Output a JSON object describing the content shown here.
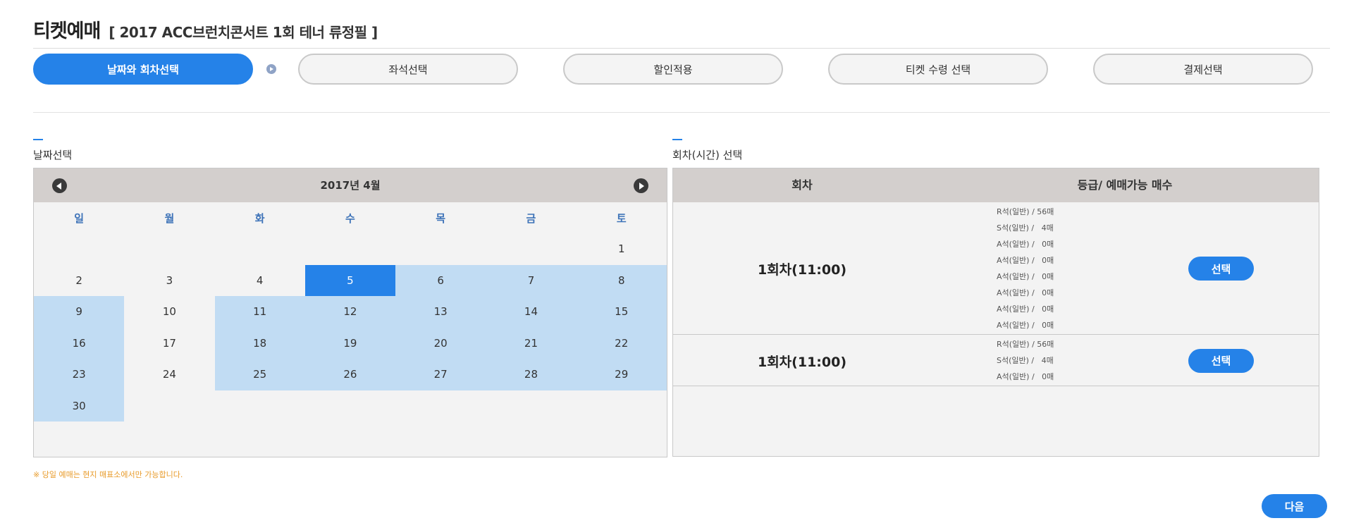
{
  "page": {
    "title": "티켓예매",
    "event": "[ 2017 ACC브런치콘서트 1회 테너 류정필 ]"
  },
  "steps": [
    {
      "label": "날짜와 회차선택",
      "active": true
    },
    {
      "label": "좌석선택",
      "active": false
    },
    {
      "label": "할인적용",
      "active": false
    },
    {
      "label": "티켓 수령 선택",
      "active": false
    },
    {
      "label": "결제선택",
      "active": false
    }
  ],
  "date_section": {
    "title": "날짜선택",
    "month": "2017년 4월",
    "weekdays": [
      "일",
      "월",
      "화",
      "수",
      "목",
      "금",
      "토"
    ],
    "weeks": [
      [
        "",
        "",
        "",
        "",
        "",
        "",
        "1"
      ],
      [
        "2",
        "3",
        "4",
        "5",
        "6",
        "7",
        "8"
      ],
      [
        "9",
        "10",
        "11",
        "12",
        "13",
        "14",
        "15"
      ],
      [
        "16",
        "17",
        "18",
        "19",
        "20",
        "21",
        "22"
      ],
      [
        "23",
        "24",
        "25",
        "26",
        "27",
        "28",
        "29"
      ],
      [
        "30",
        "",
        "",
        "",
        "",
        "",
        ""
      ]
    ],
    "selected_day": "5",
    "available_days": [
      "5",
      "6",
      "7",
      "8",
      "9",
      "11",
      "12",
      "13",
      "14",
      "15",
      "16",
      "18",
      "19",
      "20",
      "21",
      "22",
      "23",
      "25",
      "26",
      "27",
      "28",
      "29",
      "30"
    ]
  },
  "session_section": {
    "title": "회차(시간) 선택",
    "col_session": "회차",
    "col_grades": "등급/ 예매가능 매수",
    "sessions": [
      {
        "name": "1회차(11:00)",
        "button": "선택",
        "seats": [
          "R석(일반) / 56매",
          "S석(일반) /   4매",
          "A석(일반) /   0매",
          "A석(일반) /   0매",
          "A석(일반) /   0매",
          "A석(일반) /   0매",
          "A석(일반) /   0매",
          "A석(일반) /   0매"
        ]
      },
      {
        "name": "1회차(11:00)",
        "button": "선택",
        "seats": [
          "R석(일반) / 56매",
          "S석(일반) /   4매",
          "A석(일반) /   0매"
        ]
      }
    ]
  },
  "notice": "※ 당일 예매는 현지 매표소에서만 가능합니다.",
  "next_button": "다음",
  "colors": {
    "accent": "#2582e8",
    "available_day": "#c1dcf3",
    "header_bg": "#d3cfcd",
    "notice": "#e89b2a"
  }
}
